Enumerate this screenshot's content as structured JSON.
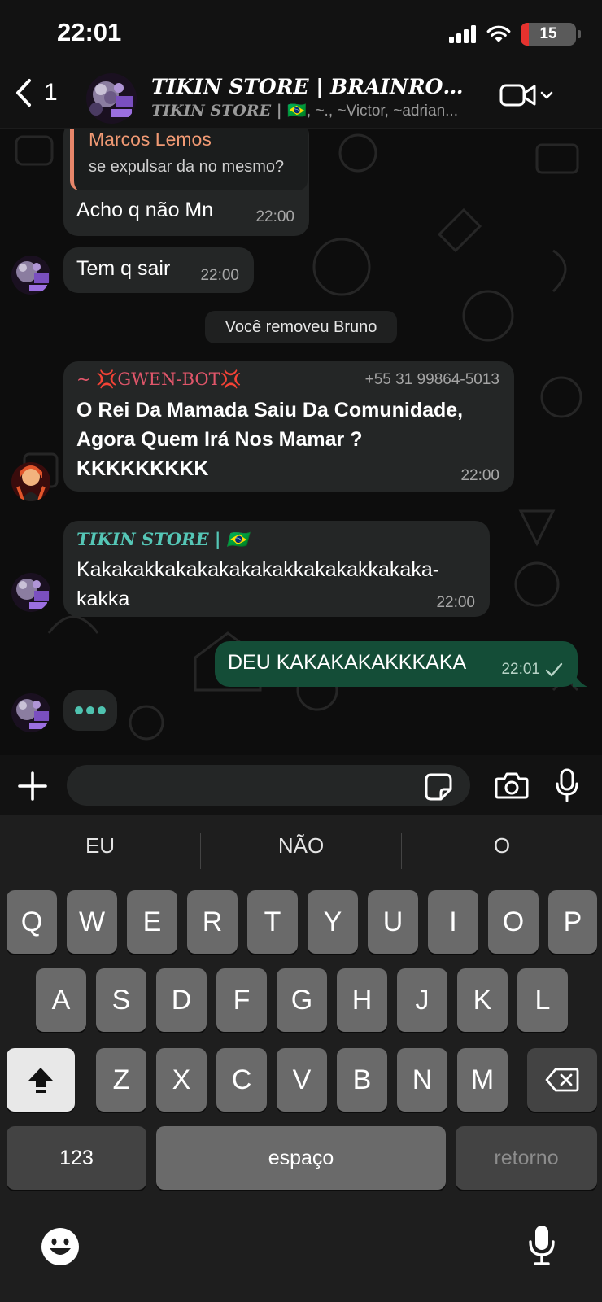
{
  "status_bar": {
    "time": "22:01",
    "battery_level": "15",
    "battery_fraction": 0.15
  },
  "header": {
    "back_count": "1",
    "title": "TIKIN  STORE | BRAINROT |...",
    "subtitle_store": "TIKIN  STORE | ",
    "subtitle_flag": "🇧🇷",
    "subtitle_rest": ", ~., ~Victor, ~adrian..."
  },
  "messages": {
    "m1": {
      "quote_name": "Marcos Lemos",
      "quote_text": "se expulsar da no mesmo?",
      "text": "Acho q não Mn",
      "time": "22:00"
    },
    "m2": {
      "text": "Tem q sair",
      "time": "22:00"
    },
    "system": {
      "text": "Você removeu Bruno"
    },
    "m3": {
      "sender": "~ 💢GWEN-BOT💢",
      "phone": "+55 31 99864-5013",
      "text": "O Rei Da Mamada Saiu Da Comunidade, Agora Quem Irá Nos Mamar ? KKKKKKKKK",
      "time": "22:00"
    },
    "m4": {
      "sender": "TIKIN  STORE | 🇧🇷",
      "text": "Kakakakkakakakakakakkakakakkakaka-kakka",
      "time": "22:00"
    },
    "m5": {
      "text": "DEU KAKAKAKAKKKAKA",
      "time": "22:01"
    }
  },
  "input": {
    "placeholder": ""
  },
  "keyboard": {
    "suggestions": [
      "EU",
      "NÃO",
      "O"
    ],
    "row1": [
      "Q",
      "W",
      "E",
      "R",
      "T",
      "Y",
      "U",
      "I",
      "O",
      "P"
    ],
    "row2": [
      "A",
      "S",
      "D",
      "F",
      "G",
      "H",
      "J",
      "K",
      "L"
    ],
    "row3": [
      "Z",
      "X",
      "C",
      "V",
      "B",
      "N",
      "M"
    ],
    "numbers_label": "123",
    "space_label": "espaço",
    "return_label": "retorno"
  },
  "colors": {
    "incoming_bubble": "#242626",
    "outgoing_bubble": "#144d37",
    "quote_accent": "#e7866a",
    "bot_name": "#e0566a",
    "store_name": "#55c6b6",
    "typing_dots": "#4fc3b0"
  }
}
